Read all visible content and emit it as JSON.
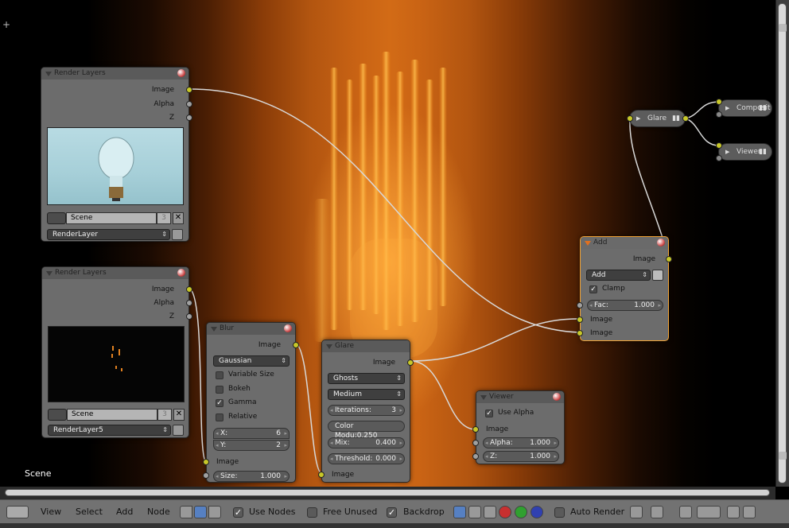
{
  "nodes": {
    "render_layers_1": {
      "title": "Render Layers",
      "out_image": "Image",
      "out_alpha": "Alpha",
      "out_z": "Z",
      "scene": "Scene",
      "scene_num": "3",
      "layer": "RenderLayer"
    },
    "render_layers_2": {
      "title": "Render Layers",
      "out_image": "Image",
      "out_alpha": "Alpha",
      "out_z": "Z",
      "scene": "Scene",
      "scene_num": "3",
      "layer": "RenderLayer5"
    },
    "blur": {
      "title": "Blur",
      "out_image": "Image",
      "filter": "Gaussian",
      "variable_size": "Variable Size",
      "bokeh": "Bokeh",
      "gamma": "Gamma",
      "relative": "Relative",
      "x_label": "X:",
      "x_value": "6",
      "y_label": "Y:",
      "y_value": "2",
      "in_image": "Image",
      "size_label": "Size:",
      "size_value": "1.000"
    },
    "glare": {
      "title": "Glare",
      "out_image": "Image",
      "type": "Ghosts",
      "quality": "Medium",
      "iterations_label": "Iterations:",
      "iterations_value": "3",
      "color_mod": "Color Modu:0.250",
      "mix_label": "Mix:",
      "mix_value": "0.400",
      "threshold_label": "Threshold:",
      "threshold_value": "0.000",
      "in_image": "Image"
    },
    "viewer": {
      "title": "Viewer",
      "use_alpha": "Use Alpha",
      "in_image": "Image",
      "alpha_label": "Alpha:",
      "alpha_value": "1.000",
      "z_label": "Z:",
      "z_value": "1.000"
    },
    "add": {
      "title": "Add",
      "out_image": "Image",
      "mode": "Add",
      "clamp": "Clamp",
      "fac_label": "Fac:",
      "fac_value": "1.000",
      "in_image1": "Image",
      "in_image2": "Image"
    },
    "glare_small": {
      "title": "Glare"
    },
    "composite_small": {
      "title": "Composit"
    },
    "viewer_small": {
      "title": "Viewer"
    }
  },
  "scene_label": "Scene",
  "header": {
    "view": "View",
    "select": "Select",
    "add": "Add",
    "node": "Node",
    "use_nodes": "Use Nodes",
    "free_unused": "Free Unused",
    "backdrop": "Backdrop",
    "auto_render": "Auto Render"
  },
  "colors": {
    "socket_image": "#c8c828",
    "socket_value": "#a0a0a0",
    "active_border": "#f0a030",
    "node_body": "#6c6c6c"
  }
}
